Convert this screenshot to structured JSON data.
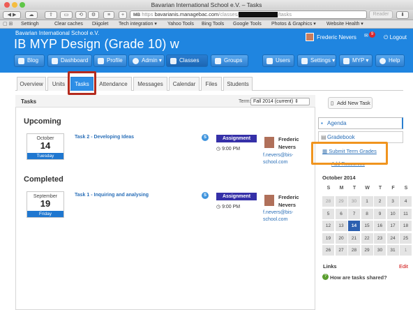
{
  "browser": {
    "title": "Bavarian International School e.V. – Tasks",
    "url_https": "https",
    "url_host": "bavarianis.managebac.com",
    "url_path": "/classes/",
    "url_tail": "/tasks",
    "url_badge": "MB",
    "reader": "Reader",
    "bookmarks": [
      "Settingh",
      "Clear caches",
      "Diigolet",
      "Tech integration ▾",
      "Yahoo Tools",
      "Bing Tools",
      "Google Tools",
      "Photos & Graphics ▾",
      "Website Health ▾"
    ]
  },
  "header": {
    "school": "Bavarian International School e.V.",
    "course": "IB MYP Design (Grade 10) w",
    "user": "Frederic Nevers",
    "logout": "Logout",
    "notif_count": "9"
  },
  "nav": {
    "blog": "Blog",
    "dashboard": "Dashboard",
    "profile": "Profile",
    "admin": "Admin ▾",
    "classes": "Classes",
    "groups": "Groups",
    "users": "Users",
    "settings": "Settings ▾",
    "myp": "MYP ▾",
    "help": "Help"
  },
  "tabs": [
    "Overview",
    "Units",
    "Tasks",
    "Attendance",
    "Messages",
    "Calendar",
    "Files",
    "Students"
  ],
  "panel": {
    "title": "Tasks",
    "term_label": "Term:",
    "term_value": "Fall 2014 (current)  ⇕"
  },
  "upcoming": {
    "heading": "Upcoming",
    "month": "October",
    "day": "14",
    "weekday": "Tuesday",
    "task": "Task 2 - Developing Ideas",
    "badge": "S",
    "type": "Assignment",
    "time": "9:00 PM",
    "teacher_first": "Frederic",
    "teacher_last": "Nevers",
    "email1": "f.nevers@bis-",
    "email2": "school.com"
  },
  "completed": {
    "heading": "Completed",
    "month": "September",
    "day": "19",
    "weekday": "Friday",
    "task": "Task 1 - Inquiring and analysing",
    "badge": "S",
    "type": "Assignment",
    "time": "9:00 PM",
    "teacher_first": "Frederic",
    "teacher_last": "Nevers",
    "email1": "f.nevers@bis-",
    "email2": "school.com"
  },
  "sidebar": {
    "add_task": "Add New Task",
    "agenda": "Agenda",
    "gradebook": "Gradebook",
    "submit_grades": "Submit Term Grades",
    "add_resources": "Add Resources",
    "calendar_title": "October 2014",
    "day_headers": [
      "S",
      "M",
      "T",
      "W",
      "T",
      "F",
      "S"
    ],
    "weeks": [
      [
        "28",
        "29",
        "30",
        "1",
        "2",
        "3",
        "4"
      ],
      [
        "5",
        "6",
        "7",
        "8",
        "9",
        "10",
        "11"
      ],
      [
        "12",
        "13",
        "14",
        "15",
        "16",
        "17",
        "18"
      ],
      [
        "19",
        "20",
        "21",
        "22",
        "23",
        "24",
        "25"
      ],
      [
        "26",
        "27",
        "28",
        "29",
        "30",
        "31",
        "1"
      ]
    ],
    "today": "14",
    "links_label": "Links",
    "edit": "Edit",
    "help_link": "How are tasks shared?"
  },
  "colors": {
    "header": "#1f85e0",
    "highlight_red": "#b42a1e",
    "highlight_orange": "#f0941e",
    "assignment": "#3530a8"
  }
}
